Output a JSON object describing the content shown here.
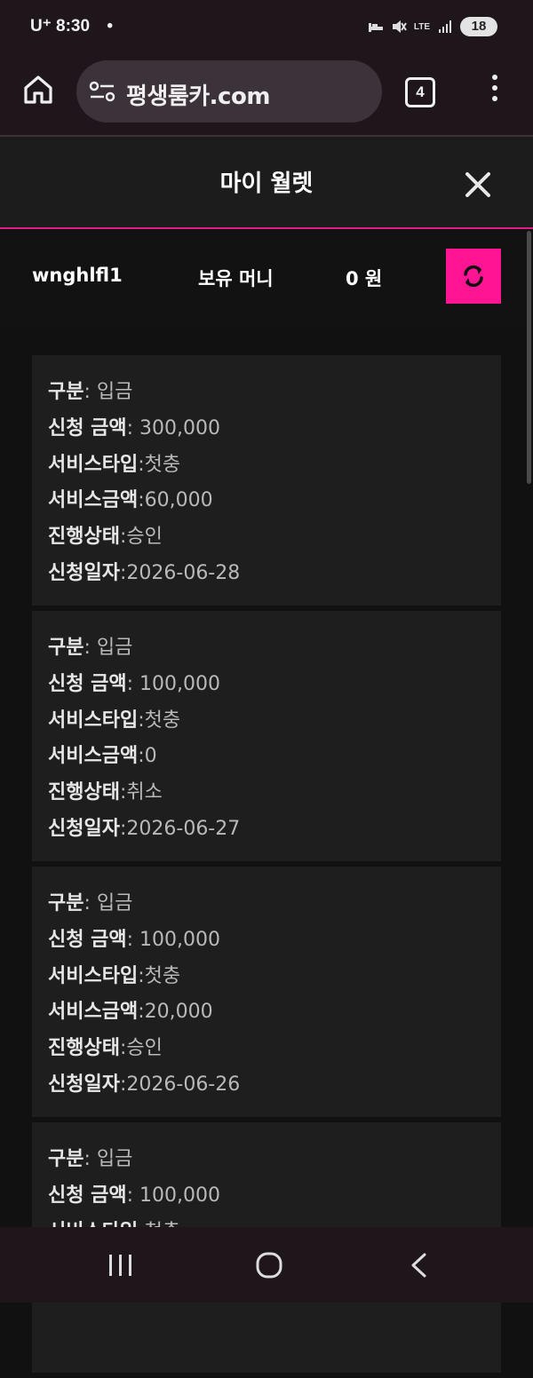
{
  "status_bar": {
    "carrier": "U⁺",
    "time": "8:30",
    "dot": "•",
    "battery": "18",
    "network": "LTE"
  },
  "browser": {
    "url": "평생룸카.com",
    "tab_count": "4"
  },
  "modal": {
    "title": "마이 월렛"
  },
  "wallet": {
    "username": "wnghlfl1",
    "money_label": "보유 머니",
    "money_value": "0 원"
  },
  "colors": {
    "accent": "#ff1493",
    "divider": "#e11c8b",
    "card_bg": "#1e1e1e"
  },
  "labels": {
    "type": "구분",
    "amount": "신청 금액",
    "service_type": "서비스타입",
    "service_amount": "서비스금액",
    "status": "진행상태",
    "date": "신청일자"
  },
  "transactions": [
    {
      "type": "입금",
      "amount": "300,000",
      "service_type": "첫충",
      "service_amount": "60,000",
      "status": "승인",
      "date": "2026-06-28"
    },
    {
      "type": "입금",
      "amount": "100,000",
      "service_type": "첫충",
      "service_amount": "0",
      "status": "취소",
      "date": "2026-06-27"
    },
    {
      "type": "입금",
      "amount": "100,000",
      "service_type": "첫충",
      "service_amount": "20,000",
      "status": "승인",
      "date": "2026-06-26"
    },
    {
      "type": "입금",
      "amount": "100,000",
      "service_type": "첫충"
    }
  ]
}
